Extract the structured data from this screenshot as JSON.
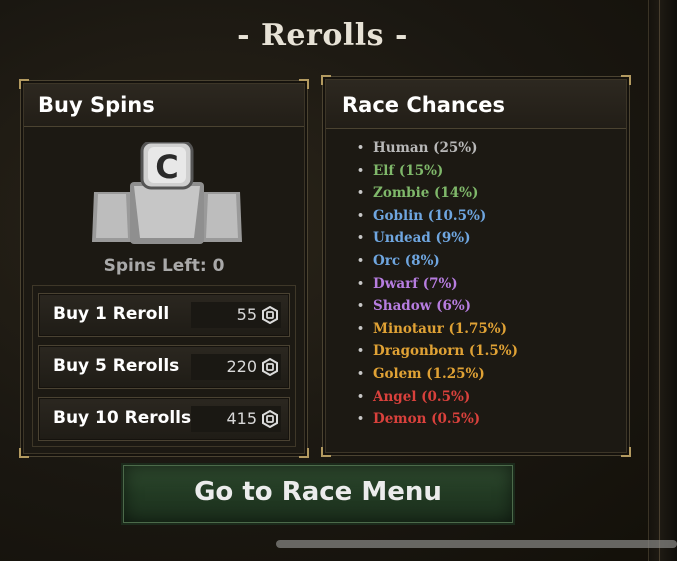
{
  "title": "- Rerolls -",
  "buy_spins": {
    "title": "Buy Spins",
    "icon": "robux-stack-icon",
    "spins_left": "Spins Left: 0",
    "buttons": [
      {
        "label": "Buy 1 Reroll",
        "price": "55"
      },
      {
        "label": "Buy 5 Rerolls",
        "price": "220"
      },
      {
        "label": "Buy 10 Rerolls",
        "price": "415"
      }
    ]
  },
  "race_chances": {
    "title": "Race Chances",
    "races": [
      {
        "text": "Human (25%)",
        "color": "#b8b8b8"
      },
      {
        "text": "Elf (15%)",
        "color": "#7fb86a"
      },
      {
        "text": "Zombie (14%)",
        "color": "#7fb86a"
      },
      {
        "text": "Goblin (10.5%)",
        "color": "#6fa6e0"
      },
      {
        "text": "Undead (9%)",
        "color": "#6fa6e0"
      },
      {
        "text": "Orc (8%)",
        "color": "#6fa6e0"
      },
      {
        "text": "Dwarf (7%)",
        "color": "#b77de0"
      },
      {
        "text": "Shadow (6%)",
        "color": "#b77de0"
      },
      {
        "text": "Minotaur (1.75%)",
        "color": "#e0a235"
      },
      {
        "text": "Dragonborn (1.5%)",
        "color": "#e0a235"
      },
      {
        "text": "Golem (1.25%)",
        "color": "#e0a235"
      },
      {
        "text": "Angel (0.5%)",
        "color": "#d9413c"
      },
      {
        "text": "Demon (0.5%)",
        "color": "#d9413c"
      }
    ]
  },
  "go_button": "Go to Race Menu",
  "colors": {
    "accent": "#b39a60",
    "go_button": "#2f4a2f"
  }
}
